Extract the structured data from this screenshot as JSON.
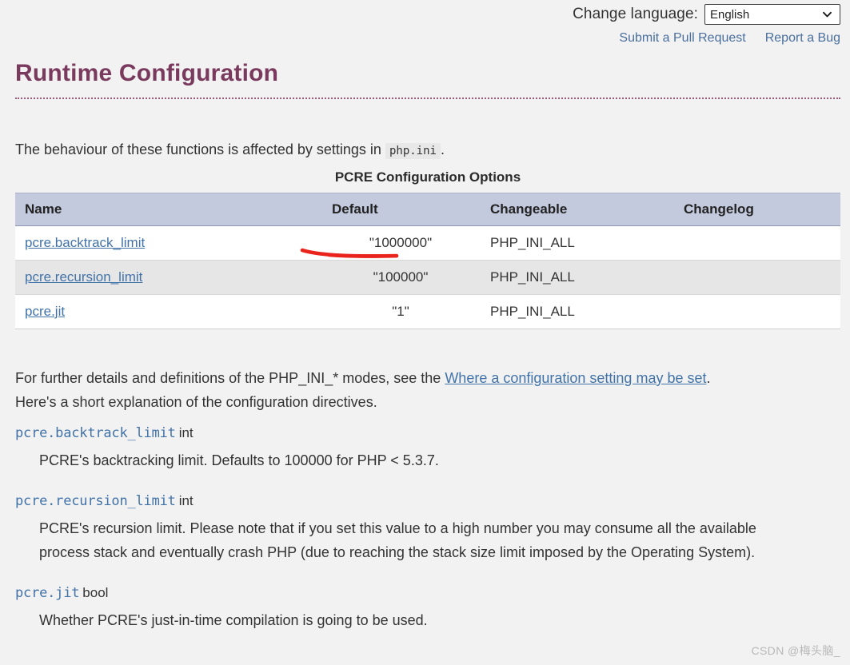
{
  "topbar": {
    "language_label": "Change language:",
    "language_selected": "English",
    "language_options": [
      "English"
    ],
    "chevron_icon": "chevron-down-icon",
    "pull_request_link": "Submit a Pull Request",
    "report_bug_link": "Report a Bug"
  },
  "page": {
    "title": "Runtime Configuration",
    "intro_before": "The behaviour of these functions is affected by settings in",
    "intro_code": "php.ini",
    "intro_after": "."
  },
  "table": {
    "caption": "PCRE Configuration Options",
    "columns": [
      "Name",
      "Default",
      "Changeable",
      "Changelog"
    ],
    "rows": [
      {
        "name": "pcre.backtrack_limit",
        "default": "\"1000000\"",
        "changeable": "PHP_INI_ALL",
        "changelog": ""
      },
      {
        "name": "pcre.recursion_limit",
        "default": "\"100000\"",
        "changeable": "PHP_INI_ALL",
        "changelog": ""
      },
      {
        "name": "pcre.jit",
        "default": "\"1\"",
        "changeable": "PHP_INI_ALL",
        "changelog": ""
      }
    ]
  },
  "annotation": {
    "shape": "red-underline-stroke",
    "target_text": "\"1000000\"",
    "color": "#e8241c"
  },
  "body": {
    "para1_before": "For further details and definitions of the PHP_INI_* modes, see the",
    "para1_link": "Where a configuration setting may be set",
    "para1_after": ".",
    "para2": "Here's a short explanation of the configuration directives."
  },
  "definitions": [
    {
      "name": "pcre.backtrack_limit",
      "type": "int",
      "description": "PCRE's backtracking limit. Defaults to 100000 for PHP < 5.3.7."
    },
    {
      "name": "pcre.recursion_limit",
      "type": "int",
      "description": "PCRE's recursion limit. Please note that if you set this value to a high number you may consume all the available process stack and eventually crash PHP (due to reaching the stack size limit imposed by the Operating System)."
    },
    {
      "name": "pcre.jit",
      "type": "bool",
      "description": "Whether PCRE's just-in-time compilation is going to be used."
    }
  ],
  "watermark": "CSDN @梅头脑_",
  "colors": {
    "background": "#f2f2f2",
    "heading": "#7a3a5e",
    "link": "#4273a8",
    "table_header_bg": "#c3cade",
    "table_row_alt_bg": "#e6e6e6",
    "annotation_red": "#e8241c"
  }
}
